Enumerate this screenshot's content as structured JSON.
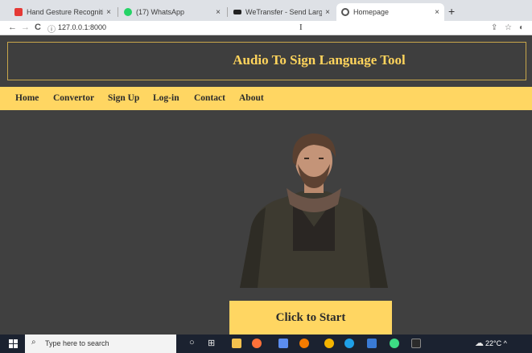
{
  "browser": {
    "tabs": [
      {
        "title": "Hand Gesture Recognition using",
        "favicon_color": "#e53935",
        "close": "×"
      },
      {
        "title": "(17) WhatsApp",
        "favicon_color": "#25d366",
        "close": "×"
      },
      {
        "title": "WeTransfer - Send Large Files &",
        "favicon_color": "#222222",
        "close": "×"
      },
      {
        "title": "Homepage",
        "favicon_color": "#555555",
        "close": "×"
      }
    ],
    "new_tab": "+",
    "url": "127.0.0.1:8000",
    "nav": {
      "back": "←",
      "forward": "→",
      "reload": "C",
      "info": "ⓘ"
    },
    "cursor": "I"
  },
  "site": {
    "title": "Audio To Sign Language Tool",
    "nav_items": [
      "Home",
      "Convertor",
      "Sign Up",
      "Log-in",
      "Contact",
      "About"
    ],
    "start_button": "Click to Start",
    "colors": {
      "accent": "#ffd662",
      "title": "#ffd45c",
      "background": "#404040"
    }
  },
  "taskbar": {
    "search_placeholder": "Type here to search",
    "weather": "22°C ^",
    "icons": [
      "windows-icon",
      "search-icon",
      "cortana-icon",
      "task-view-icon",
      "file-explorer-icon",
      "firefox-icon",
      "calendar-icon",
      "search-app-icon",
      "chrome-icon",
      "edge-icon",
      "store-icon",
      "android-studio-icon",
      "terminal-icon",
      "weather-icon"
    ]
  }
}
